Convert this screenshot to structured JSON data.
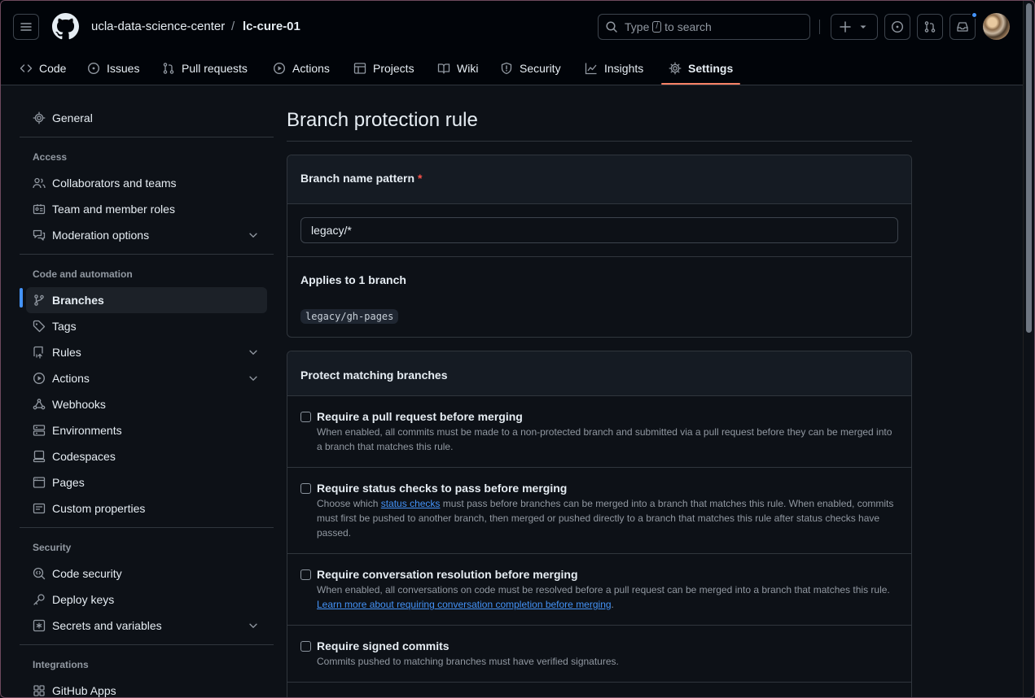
{
  "header": {
    "org": "ucla-data-science-center",
    "separator": "/",
    "repo": "lc-cure-01",
    "search_prefix": "Type",
    "search_key": "/",
    "search_suffix": "to search"
  },
  "tabs": [
    {
      "label": "Code",
      "icon": "code-icon"
    },
    {
      "label": "Issues",
      "icon": "issue-icon"
    },
    {
      "label": "Pull requests",
      "icon": "pull-request-icon"
    },
    {
      "label": "Actions",
      "icon": "play-icon"
    },
    {
      "label": "Projects",
      "icon": "table-icon"
    },
    {
      "label": "Wiki",
      "icon": "book-icon"
    },
    {
      "label": "Security",
      "icon": "shield-icon"
    },
    {
      "label": "Insights",
      "icon": "graph-icon"
    },
    {
      "label": "Settings",
      "icon": "gear-icon",
      "active": true
    }
  ],
  "sidebar": {
    "general": "General",
    "access_heading": "Access",
    "access": [
      "Collaborators and teams",
      "Team and member roles",
      "Moderation options"
    ],
    "code_heading": "Code and automation",
    "code": [
      "Branches",
      "Tags",
      "Rules",
      "Actions",
      "Webhooks",
      "Environments",
      "Codespaces",
      "Pages",
      "Custom properties"
    ],
    "security_heading": "Security",
    "security": [
      "Code security",
      "Deploy keys",
      "Secrets and variables"
    ],
    "integrations_heading": "Integrations",
    "integrations": [
      "GitHub Apps"
    ]
  },
  "main": {
    "title": "Branch protection rule",
    "pattern_label": "Branch name pattern",
    "required_mark": "*",
    "pattern_value": "legacy/*",
    "applies_label": "Applies to 1 branch",
    "branch_chip": "legacy/gh-pages",
    "protect_heading": "Protect matching branches",
    "options": [
      {
        "title": "Require a pull request before merging",
        "desc": "When enabled, all commits must be made to a non-protected branch and submitted via a pull request before they can be merged into a branch that matches this rule.",
        "checked": false
      },
      {
        "title": "Require status checks to pass before merging",
        "desc_pre": "Choose which ",
        "desc_link": "status checks",
        "desc_post": " must pass before branches can be merged into a branch that matches this rule. When enabled, commits must first be pushed to another branch, then merged or pushed directly to a branch that matches this rule after status checks have passed.",
        "checked": false
      },
      {
        "title": "Require conversation resolution before merging",
        "desc_pre": "When enabled, all conversations on code must be resolved before a pull request can be merged into a branch that matches this rule. ",
        "desc_link": "Learn more about requiring conversation completion before merging",
        "desc_post": ".",
        "checked": false
      },
      {
        "title": "Require signed commits",
        "desc": "Commits pushed to matching branches must have verified signatures.",
        "checked": false
      }
    ]
  },
  "colors": {
    "background": "#0d1117",
    "header": "#010409",
    "accent": "#4493f8",
    "tab_underline": "#f78166",
    "required": "#f85149"
  }
}
